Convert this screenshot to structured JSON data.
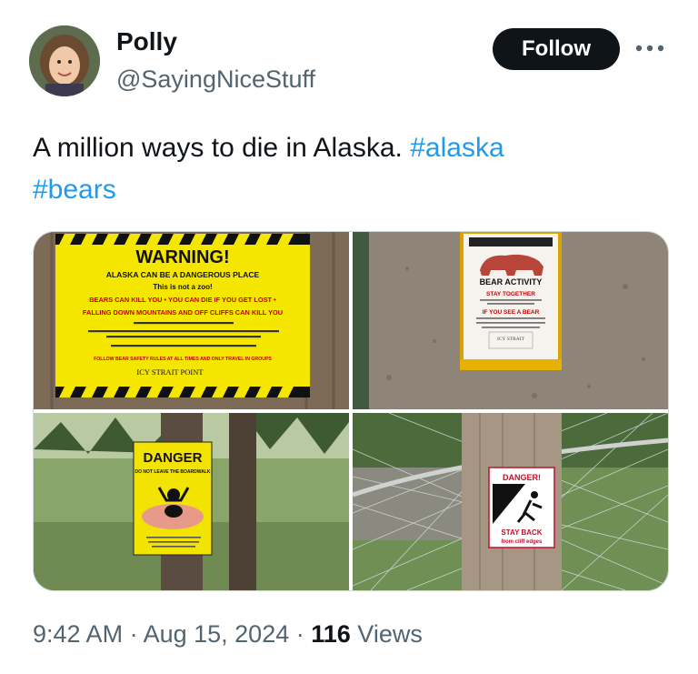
{
  "author": {
    "name": "Polly",
    "handle": "@SayingNiceStuff",
    "follow_label": "Follow",
    "more_icon": "more-horizontal-icon"
  },
  "tweet": {
    "text": "A million ways to die in Alaska.",
    "hashtags": [
      "#alaska",
      "#bears"
    ]
  },
  "media": {
    "photos": [
      {
        "heading": "WARNING!",
        "lines": [
          "ALASKA CAN BE A DANGEROUS PLACE",
          "This is not a zoo!",
          "BEARS CAN KILL YOU • YOU CAN DIE IF YOU GET LOST •",
          "FALLING DOWN MOUNTAINS AND OFF CLIFFS CAN KILL YOU"
        ],
        "footer": "FOLLOW BEAR SAFETY RULES AT ALL TIMES AND ONLY TRAVEL IN GROUPS",
        "brand": "ICY STRAIT POINT"
      },
      {
        "heading": "BEAR ACTIVITY",
        "lines": [
          "STAY TOGETHER",
          "IF YOU SEE A BEAR"
        ],
        "brand": "ICY STRAIT"
      },
      {
        "heading": "DANGER",
        "lines": [
          "DO NOT LEAVE THE BOARDWALK"
        ]
      },
      {
        "heading": "DANGER!",
        "lines": [
          "STAY BACK",
          "from cliff edges"
        ]
      }
    ]
  },
  "meta": {
    "time": "9:42 AM",
    "sep1": " · ",
    "date": "Aug 15, 2024",
    "sep2": " · ",
    "views_count": "116",
    "views_label": " Views"
  }
}
